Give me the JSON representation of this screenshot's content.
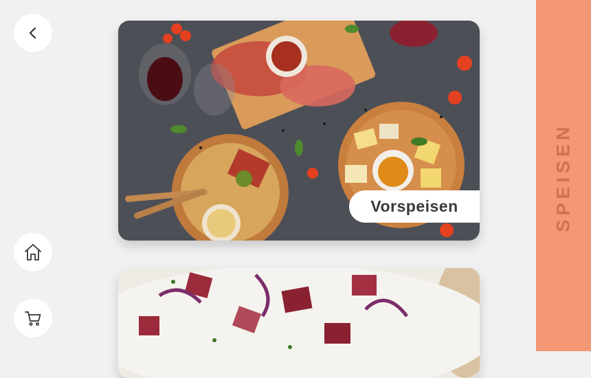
{
  "nav": {
    "back_icon": "chevron-left-icon",
    "home_icon": "home-icon",
    "cart_icon": "shopping-cart-icon"
  },
  "categories": [
    {
      "label": "Vorspeisen",
      "image": "antipasti-platter"
    },
    {
      "label": "",
      "image": "flammkuchen-pizza"
    }
  ],
  "side_panel": {
    "title": "SPEISEN",
    "color": "#f39774"
  },
  "colors": {
    "background": "#f1f1f1",
    "card_label_bg": "#ffffff",
    "text": "#3a3a3a"
  }
}
